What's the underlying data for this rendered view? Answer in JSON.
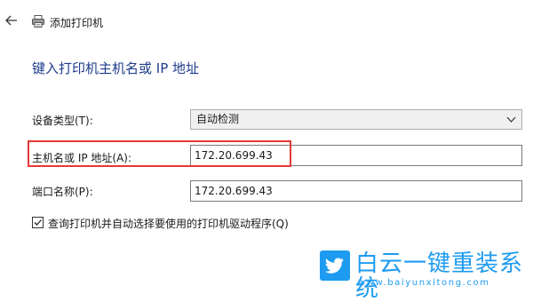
{
  "titlebar": {
    "back_icon": "back-arrow-icon",
    "printer_icon": "printer-icon",
    "title": "添加打印机"
  },
  "heading": "键入打印机主机名或 IP 地址",
  "form": {
    "device_type": {
      "label": "设备类型(T):",
      "value": "自动检测",
      "icon": "chevron-down-icon"
    },
    "hostname": {
      "label": "主机名或 IP 地址(A):",
      "value": "172.20.699.43"
    },
    "port_name": {
      "label": "端口名称(P):",
      "value": "172.20.699.43"
    },
    "query_driver": {
      "label": "查询打印机并自动选择要使用的打印机驱动程序(Q)",
      "checked": true
    }
  },
  "watermark": {
    "title": "白云一键重装系统",
    "url": "www.baiyunxitong.com"
  },
  "colors": {
    "heading": "#1f3b8c",
    "highlight": "#e53935",
    "watermark": "#1d9bf0"
  }
}
